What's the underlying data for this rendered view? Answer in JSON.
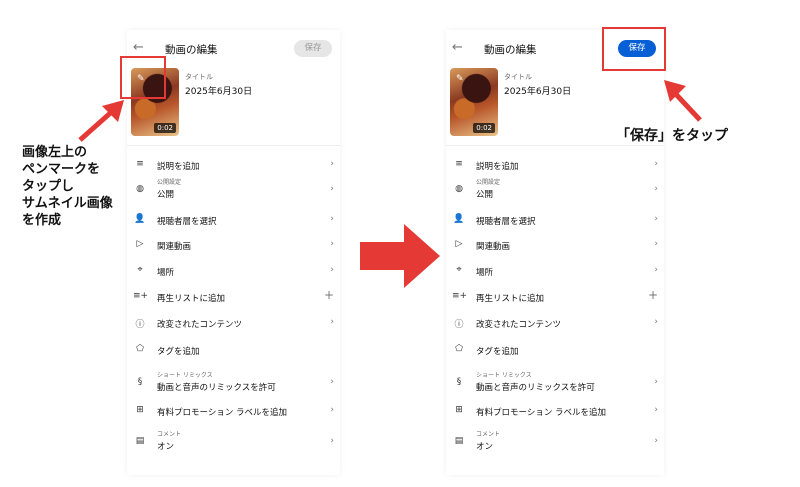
{
  "screens": [
    {
      "header": {
        "back_icon": "back-arrow-icon",
        "title": "動画の編集",
        "save_label": "保存"
      },
      "video": {
        "title_label": "タイトル",
        "title_value": "2025年6月30日",
        "duration": "0:02"
      },
      "menu": [
        {
          "icon": "≡",
          "label": "説明を追加",
          "sublabel": "",
          "action": "›"
        },
        {
          "icon": "◍",
          "label": "公開",
          "sublabel": "公開設定",
          "action": "›"
        },
        {
          "icon": "👤",
          "label": "視聴者層を選択",
          "sublabel": "",
          "action": "›"
        },
        {
          "icon": "▷",
          "label": "関連動画",
          "sublabel": "",
          "action": "›"
        },
        {
          "icon": "⌖",
          "label": "場所",
          "sublabel": "",
          "action": "›"
        },
        {
          "icon": "≡+",
          "label": "再生リストに追加",
          "sublabel": "",
          "action": "+"
        },
        {
          "icon": "ⓘ",
          "label": "改変されたコンテンツ",
          "sublabel": "",
          "action": "›"
        },
        {
          "icon": "⬠",
          "label": "タグを追加",
          "sublabel": "",
          "action": ""
        },
        {
          "icon": "§",
          "label": "動画と音声のリミックスを許可",
          "sublabel": "ショート リミックス",
          "action": "›"
        },
        {
          "icon": "⊞",
          "label": "有料プロモーション ラベルを追加",
          "sublabel": "",
          "action": "›"
        },
        {
          "icon": "▤",
          "label": "オン",
          "sublabel": "コメント",
          "action": "›"
        }
      ]
    },
    {
      "header": {
        "back_icon": "back-arrow-icon",
        "title": "動画の編集",
        "save_label": "保存"
      },
      "video": {
        "title_label": "タイトル",
        "title_value": "2025年6月30日",
        "duration": "0:02"
      },
      "menu": [
        {
          "icon": "≡",
          "label": "説明を追加",
          "sublabel": "",
          "action": "›"
        },
        {
          "icon": "◍",
          "label": "公開",
          "sublabel": "公開設定",
          "action": "›"
        },
        {
          "icon": "👤",
          "label": "視聴者層を選択",
          "sublabel": "",
          "action": "›"
        },
        {
          "icon": "▷",
          "label": "関連動画",
          "sublabel": "",
          "action": "›"
        },
        {
          "icon": "⌖",
          "label": "場所",
          "sublabel": "",
          "action": "›"
        },
        {
          "icon": "≡+",
          "label": "再生リストに追加",
          "sublabel": "",
          "action": "+"
        },
        {
          "icon": "ⓘ",
          "label": "改変されたコンテンツ",
          "sublabel": "",
          "action": "›"
        },
        {
          "icon": "⬠",
          "label": "タグを追加",
          "sublabel": "",
          "action": ""
        },
        {
          "icon": "§",
          "label": "動画と音声のリミックスを許可",
          "sublabel": "ショート リミックス",
          "action": "›"
        },
        {
          "icon": "⊞",
          "label": "有料プロモーション ラベルを追加",
          "sublabel": "",
          "action": "›"
        },
        {
          "icon": "▤",
          "label": "オン",
          "sublabel": "コメント",
          "action": "›"
        }
      ]
    }
  ],
  "annotations": {
    "left_note": "画像左上の\nペンマークを\nタップし\nサムネイル画像\nを作成",
    "right_note": "「保存」をタップ",
    "highlight_color": "#e53935",
    "save_enabled_color": "#065fd4"
  }
}
